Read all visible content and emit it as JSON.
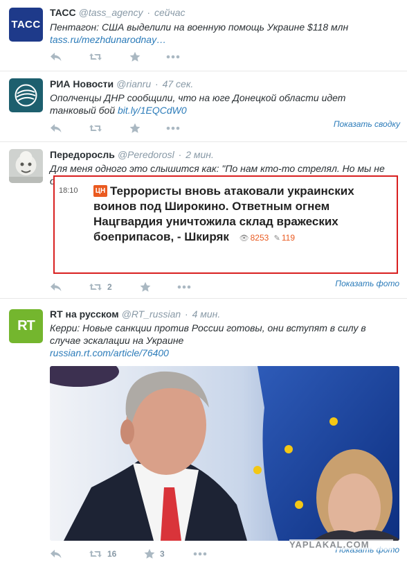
{
  "colors": {
    "link": "#2b7bb9",
    "muted": "#8899a6",
    "card_border": "#d81f1f",
    "card_accent": "#ea5a20"
  },
  "tweets": [
    {
      "fullname": "ТАСС",
      "username": "@tass_agency",
      "sep": "·",
      "time": "сейчас",
      "avatar_label": "ТАСС",
      "text": "Пентагон: США выделили на военную помощь Украине $118 млн",
      "link": "tass.ru/mezhdunarodnay…",
      "expand": "",
      "retweets": "",
      "favorites": ""
    },
    {
      "fullname": "РИА Новости",
      "username": "@rianru",
      "sep": "·",
      "time": "47 сек.",
      "text": "Ополченцы ДНР сообщили, что на юге Донецкой области идет танковый бой",
      "link": "bit.ly/1EQCdW0",
      "expand": "Показать сводку",
      "retweets": "",
      "favorites": ""
    },
    {
      "fullname": "Передоросль",
      "username": "@Peredorosl",
      "sep": "·",
      "time": "2 мин.",
      "text": "Для меня одного это слышится как: \"По нам кто-то стрелял. Но мы не остались в долгу и тоже разъебали какой-то дом\"?",
      "card": {
        "time": "18:10",
        "logo": "ЦН",
        "title": "Террористы вновь атаковали украинских воинов под Широкино. Ответным огнем Нацгвардия уничтожила склад вражеских боеприпасов, - Шкиряк",
        "views": "8253",
        "comments": "119"
      },
      "expand": "Показать фото",
      "retweets": "2",
      "favorites": ""
    },
    {
      "fullname": "RT на русском",
      "username": "@RT_russian",
      "sep": "·",
      "time": "4 мин.",
      "avatar_label": "RT",
      "text": "Керри: Новые санкции против России готовы, они вступят в силу в случае эскалации на Украине",
      "link": "russian.rt.com/article/76400",
      "expand": "Показать фото",
      "retweets": "16",
      "favorites": "3"
    }
  ],
  "watermark": "YAPLAKAL.COM"
}
